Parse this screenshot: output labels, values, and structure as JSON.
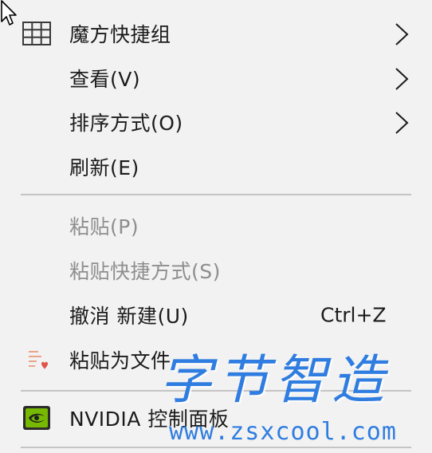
{
  "menu": {
    "items": [
      {
        "label": "魔方快捷组",
        "icon": "grid-icon",
        "has_submenu": true
      },
      {
        "label": "查看(V)",
        "has_submenu": true
      },
      {
        "label": "排序方式(O)",
        "has_submenu": true
      },
      {
        "label": "刷新(E)"
      },
      {
        "label": "粘贴(P)",
        "disabled": true
      },
      {
        "label": "粘贴快捷方式(S)",
        "disabled": true
      },
      {
        "label": "撤消 新建(U)",
        "shortcut": "Ctrl+Z"
      },
      {
        "label": "粘贴为文件",
        "icon": "paste-file-icon"
      },
      {
        "label": "NVIDIA 控制面板",
        "icon": "nvidia-icon"
      }
    ]
  },
  "watermark": {
    "title": "字节智造",
    "url": "www.zsxcool.com"
  },
  "colors": {
    "menu_background": "#f2f2f2",
    "text": "#1b1b1b",
    "disabled_text": "#8e8e8e",
    "separator": "#c4c4c4",
    "watermark": "#2f7de0"
  }
}
